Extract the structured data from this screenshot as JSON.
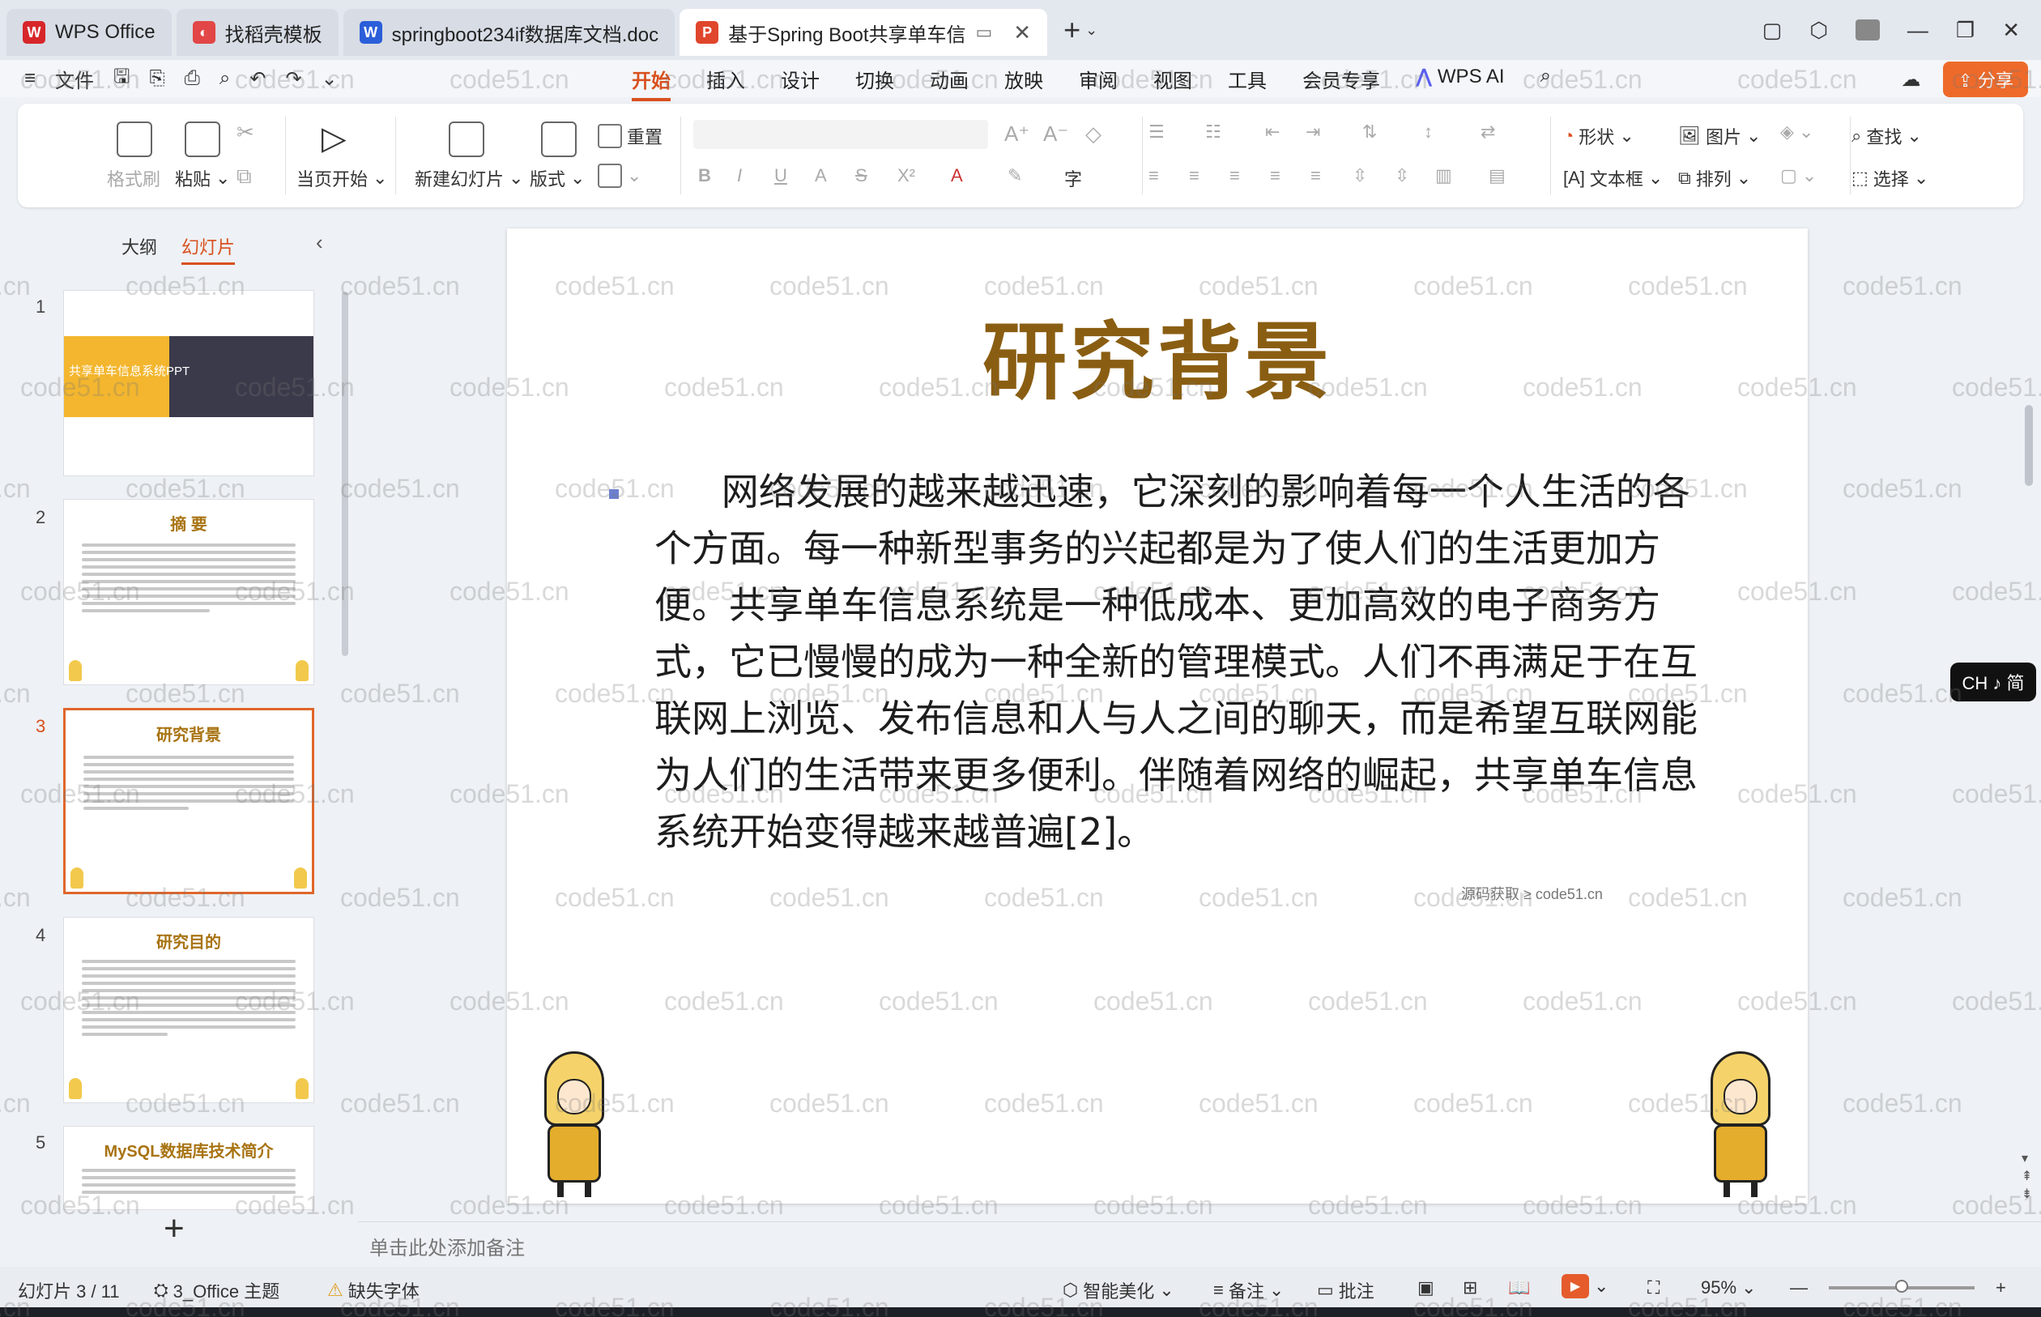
{
  "tabs": [
    {
      "label": "WPS Office",
      "icon": "wps-logo-icon",
      "color": "#d7262a"
    },
    {
      "label": "找稻壳模板",
      "icon": "docer-icon",
      "color": "#e24646"
    },
    {
      "label": "springboot234if数据库文档.doc",
      "icon": "word-doc-icon",
      "color": "#2b5fd9"
    },
    {
      "label": "基于Spring Boot共享单车信",
      "icon": "ppt-icon",
      "color": "#e0462c"
    }
  ],
  "menubar": {
    "file": "文件",
    "menus": [
      "开始",
      "插入",
      "设计",
      "切换",
      "动画",
      "放映",
      "审阅",
      "视图",
      "工具",
      "会员专享"
    ],
    "active_menu": "开始",
    "wps_ai": "WPS AI",
    "share": "分享"
  },
  "ribbon": {
    "format_painter": "格式刷",
    "paste": "粘贴",
    "play_from_current": "当页开始",
    "new_slide": "新建幻灯片",
    "layout": "版式",
    "reset": "重置",
    "shape": "形状",
    "picture": "图片",
    "find": "查找",
    "textbox": "文本框",
    "arrange": "排列",
    "select": "选择"
  },
  "left_panel": {
    "tab_outline": "大纲",
    "tab_slides": "幻灯片",
    "thumbnails": [
      {
        "num": "1",
        "title": "共享单车信息系统PPT"
      },
      {
        "num": "2",
        "title": "摘 要"
      },
      {
        "num": "3",
        "title": "研究背景"
      },
      {
        "num": "4",
        "title": "研究目的"
      },
      {
        "num": "5",
        "title": "MySQL数据库技术简介"
      }
    ]
  },
  "slide": {
    "title": "研究背景",
    "body": "网络发展的越来越迅速，它深刻的影响着每一个人生活的各个方面。每一种新型事务的兴起都是为了使人们的生活更加方便。共享单车信息系统是一种低成本、更加高效的电子商务方式，它已慢慢的成为一种全新的管理模式。人们不再满足于在互联网上浏览、发布信息和人与人之间的聊天，而是希望互联网能为人们的生活带来更多便利。伴随着网络的崛起，共享单车信息系统开始变得越来越普遍[2]。",
    "overlay": "源码获取 ≥ code51.cn"
  },
  "notes_placeholder": "单击此处添加备注",
  "ime": "CH ♪ 简",
  "statusbar": {
    "slide_counter": "幻灯片 3 / 11",
    "theme": "3_Office 主题",
    "missing_font": "缺失字体",
    "smart_beautify": "智能美化",
    "notes": "备注",
    "comments": "批注",
    "zoom": "95%"
  },
  "watermark": "code51.cn",
  "colors": {
    "accent": "#d9501e",
    "title_gold": "#8a5e12"
  }
}
